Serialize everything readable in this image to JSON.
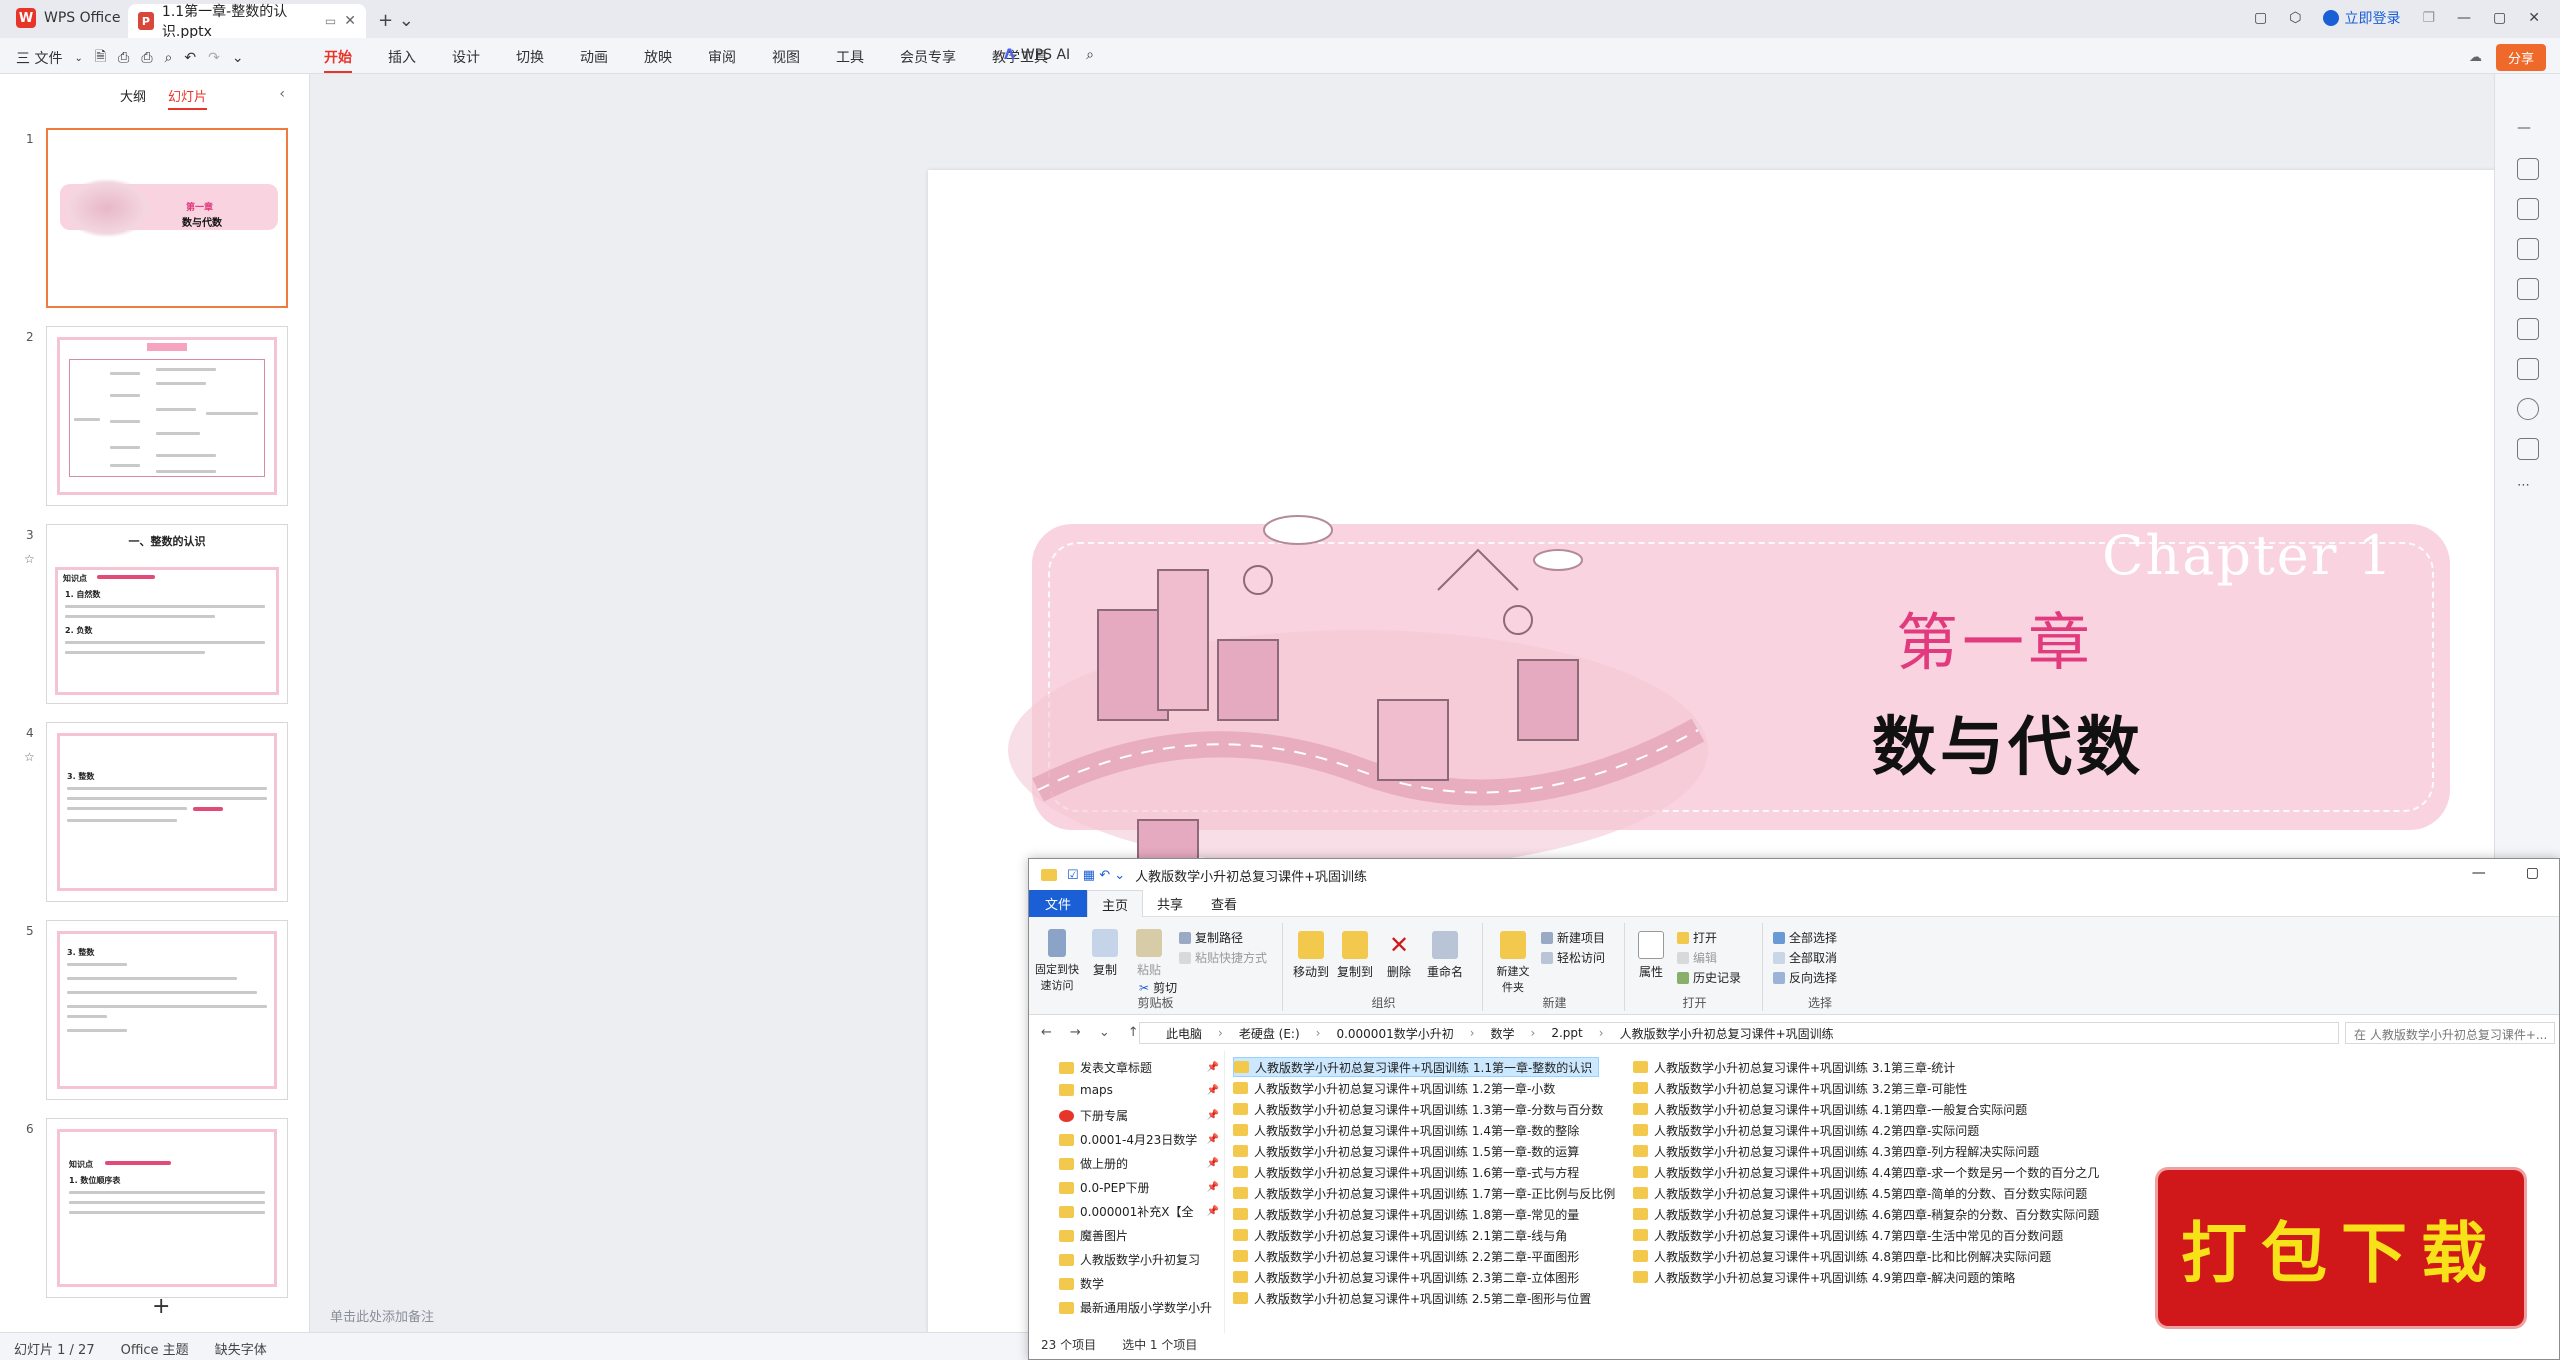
{
  "app": {
    "name": "WPS Office",
    "doc_tab": "1.1第一章-整数的认识.pptx",
    "login": "立即登录"
  },
  "menu": {
    "file": "三 文件",
    "tabs": [
      "开始",
      "插入",
      "设计",
      "切换",
      "动画",
      "放映",
      "审阅",
      "视图",
      "工具",
      "会员专享",
      "教学工具"
    ],
    "ai": "WPS AI",
    "share": "分享"
  },
  "left_panel": {
    "tabs": [
      "大纲",
      "幻灯片"
    ],
    "slide_numbers": [
      "1",
      "2",
      "3",
      "4",
      "5",
      "6"
    ],
    "thumb1_title": "第一章",
    "thumb1_sub": "数与代数",
    "thumb3_title": "一、整数的认识",
    "thumb3_kp": "知识点",
    "thumb3_heading": "1. 自然数",
    "thumb3_neg": "2. 负数",
    "thumb4_heading": "3. 整数",
    "thumb5_heading": "3. 整数",
    "thumb6_kp": "知识点",
    "thumb6_heading": "1. 数位顺序表"
  },
  "slide": {
    "chapter_en": "Chapter 1",
    "chapter_cn": "第一章",
    "subtitle": "数与代数"
  },
  "notes_placeholder": "单击此处添加备注",
  "status": {
    "slide_count": "幻灯片 1 / 27",
    "theme": "Office 主题",
    "missing_font": "缺失字体"
  },
  "explorer": {
    "title": "人教版数学小升初总复习课件+巩固训练",
    "ribbon_tabs": [
      "文件",
      "主页",
      "共享",
      "查看"
    ],
    "groups": {
      "clipboard": "剪贴板",
      "organize": "组织",
      "new": "新建",
      "open": "打开",
      "select": "选择"
    },
    "buttons": {
      "pin": "固定到快速访问",
      "copy": "复制",
      "paste": "粘贴",
      "copy_path": "复制路径",
      "paste_shortcut": "粘贴快捷方式",
      "cut": "剪切",
      "move_to": "移动到",
      "copy_to": "复制到",
      "delete": "删除",
      "rename": "重命名",
      "new_folder": "新建文件夹",
      "new_item": "新建项目",
      "easy_access": "轻松访问",
      "properties": "属性",
      "open": "打开",
      "edit": "编辑",
      "history": "历史记录",
      "select_all": "全部选择",
      "select_none": "全部取消",
      "invert": "反向选择"
    },
    "path": [
      "此电脑",
      "老硬盘 (E:)",
      "0.000001数学小升初",
      "数学",
      "2.ppt",
      "人教版数学小升初总复习课件+巩固训练"
    ],
    "search_placeholder": "在 人教版数学小升初总复习课件+...",
    "nav_items": [
      "发表文章标题",
      "maps",
      "下册专属",
      "0.0001-4月23日数学",
      "做上册的",
      "0.0-PEP下册",
      "0.000001补充X【全",
      "魔善图片",
      "人教版数学小升初复习",
      "数学",
      "最新通用版小学数学小升"
    ],
    "files_col1": [
      "人教版数学小升初总复习课件+巩固训练 1.1第一章-整数的认识",
      "人教版数学小升初总复习课件+巩固训练 1.2第一章-小数",
      "人教版数学小升初总复习课件+巩固训练 1.3第一章-分数与百分数",
      "人教版数学小升初总复习课件+巩固训练 1.4第一章-数的整除",
      "人教版数学小升初总复习课件+巩固训练 1.5第一章-数的运算",
      "人教版数学小升初总复习课件+巩固训练 1.6第一章-式与方程",
      "人教版数学小升初总复习课件+巩固训练 1.7第一章-正比例与反比例",
      "人教版数学小升初总复习课件+巩固训练 1.8第一章-常见的量",
      "人教版数学小升初总复习课件+巩固训练 2.1第二章-线与角",
      "人教版数学小升初总复习课件+巩固训练 2.2第二章-平面图形",
      "人教版数学小升初总复习课件+巩固训练 2.3第二章-立体图形",
      "人教版数学小升初总复习课件+巩固训练 2.5第二章-图形与位置"
    ],
    "files_col2": [
      "人教版数学小升初总复习课件+巩固训练 3.1第三章-统计",
      "人教版数学小升初总复习课件+巩固训练 3.2第三章-可能性",
      "人教版数学小升初总复习课件+巩固训练 4.1第四章-一般复合实际问题",
      "人教版数学小升初总复习课件+巩固训练 4.2第四章-实际问题",
      "人教版数学小升初总复习课件+巩固训练 4.3第四章-列方程解决实际问题",
      "人教版数学小升初总复习课件+巩固训练 4.4第四章-求一个数是另一个数的百分之几",
      "人教版数学小升初总复习课件+巩固训练 4.5第四章-简单的分数、百分数实际问题",
      "人教版数学小升初总复习课件+巩固训练 4.6第四章-稍复杂的分数、百分数实际问题",
      "人教版数学小升初总复习课件+巩固训练 4.7第四章-生活中常见的百分数问题",
      "人教版数学小升初总复习课件+巩固训练 4.8第四章-比和比例解决实际问题",
      "人教版数学小升初总复习课件+巩固训练 4.9第四章-解决问题的策略"
    ],
    "status_count": "23 个项目",
    "status_selected": "选中 1 个项目"
  },
  "download_badge": "打包下载",
  "colors": {
    "wps_red": "#e8352a",
    "banner_pink": "#f9d3df",
    "chapter_pink": "#e23a7f",
    "badge_red": "#d0181b",
    "badge_yellow": "#f7e21a"
  }
}
